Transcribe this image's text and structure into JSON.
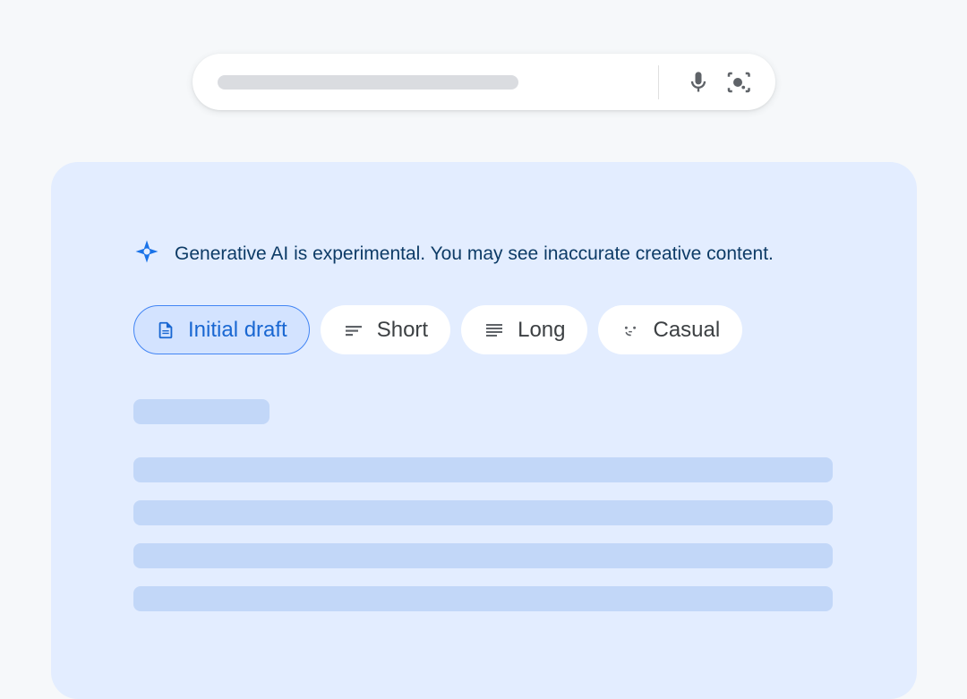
{
  "disclaimer": "Generative AI is experimental. You may see inaccurate creative content.",
  "chips": {
    "initial": "Initial draft",
    "short": "Short",
    "long": "Long",
    "casual": "Casual"
  }
}
